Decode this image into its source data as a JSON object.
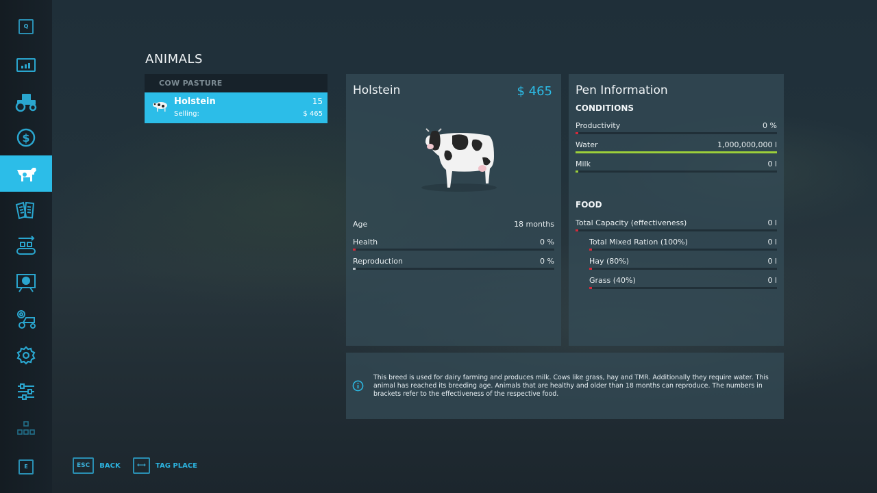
{
  "sidebar": {
    "items": [
      {
        "name": "q-key",
        "label": "Q"
      },
      {
        "name": "statistics",
        "label": ""
      },
      {
        "name": "vehicles",
        "label": ""
      },
      {
        "name": "finances",
        "label": ""
      },
      {
        "name": "animals",
        "label": "",
        "active": true
      },
      {
        "name": "contracts",
        "label": ""
      },
      {
        "name": "production",
        "label": ""
      },
      {
        "name": "help",
        "label": ""
      },
      {
        "name": "garage-settings",
        "label": ""
      },
      {
        "name": "settings",
        "label": ""
      },
      {
        "name": "general-settings",
        "label": ""
      },
      {
        "name": "hierarchy",
        "label": ""
      },
      {
        "name": "e-key",
        "label": "E"
      }
    ]
  },
  "page": {
    "title": "ANIMALS"
  },
  "list": {
    "header": "COW PASTURE",
    "rows": [
      {
        "name": "Holstein",
        "sub_label": "Selling:",
        "count": "15",
        "price": "$ 465"
      }
    ]
  },
  "animal": {
    "name": "Holstein",
    "price": "$ 465",
    "stats": [
      {
        "label": "Age",
        "value": "18 months"
      },
      {
        "label": "Health",
        "value": "0 %",
        "fill": 0,
        "color": "#d42a3a"
      },
      {
        "label": "Reproduction",
        "value": "0 %",
        "fill": 0,
        "color": "#b8c2c8"
      }
    ]
  },
  "pen": {
    "title": "Pen Information",
    "conditions_heading": "CONDITIONS",
    "conditions": [
      {
        "label": "Productivity",
        "value": "0 %",
        "fill": 0,
        "color": "#d42a3a"
      },
      {
        "label": "Water",
        "value": "1,000,000,000 l",
        "fill": 1,
        "color": "#9ccf3a"
      },
      {
        "label": "Milk",
        "value": "0 l",
        "fill": 0,
        "color": "#9ccf3a"
      }
    ],
    "food_heading": "FOOD",
    "food": [
      {
        "label": "Total Capacity (effectiveness)",
        "value": "0 l",
        "fill": 0,
        "color": "#d42a3a"
      },
      {
        "label": "Total Mixed Ration (100%)",
        "value": "0 l",
        "fill": 0,
        "color": "#d42a3a"
      },
      {
        "label": "Hay (80%)",
        "value": "0 l",
        "fill": 0,
        "color": "#d42a3a"
      },
      {
        "label": "Grass (40%)",
        "value": "0 l",
        "fill": 0,
        "color": "#d42a3a"
      }
    ]
  },
  "info": {
    "text": "This breed is used for dairy farming and produces milk. Cows like grass, hay and TMR. Additionally they require water. This animal has reached its breeding age. Animals that are healthy and older than 18 months can reproduce. The numbers in brackets refer to the effectiveness of the respective food."
  },
  "footer": {
    "back_key": "ESC",
    "back_label": "BACK",
    "tag_key": "⟷",
    "tag_label": "TAG PLACE"
  },
  "colors": {
    "accent": "#2cbde8",
    "good": "#9ccf3a",
    "bad": "#d42a3a"
  }
}
